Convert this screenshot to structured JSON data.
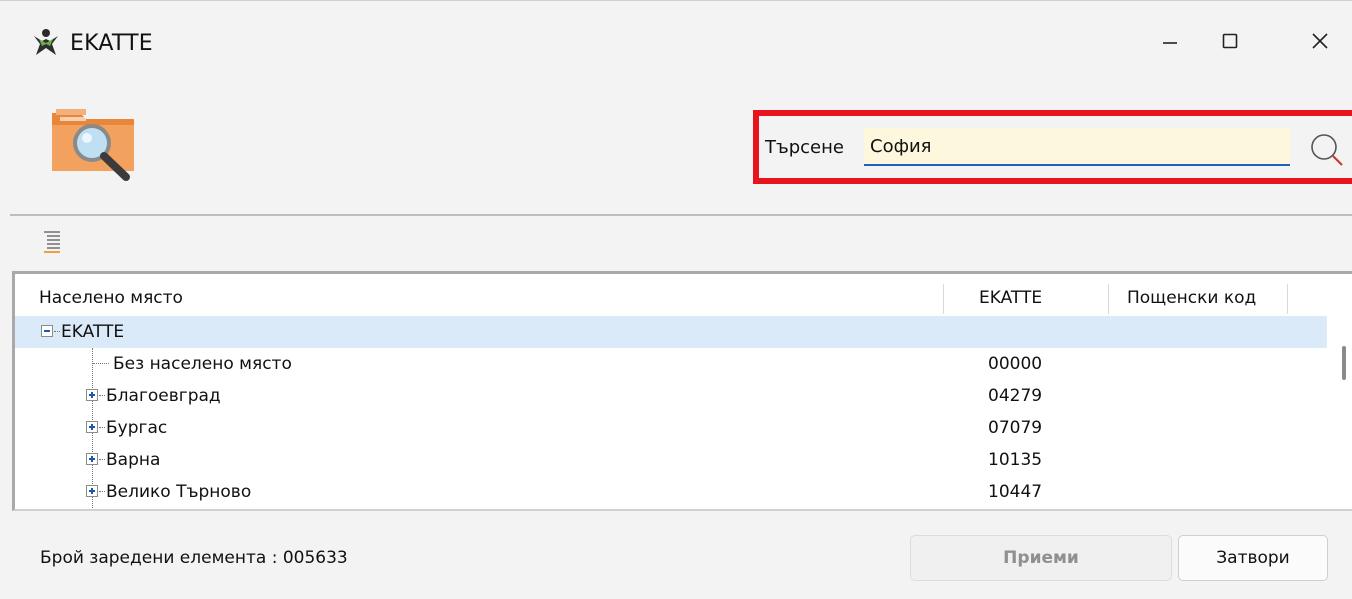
{
  "window": {
    "title": "EKATTE",
    "controls": {
      "minimize": "—",
      "maximize": "☐",
      "close": "✕"
    }
  },
  "search": {
    "label": "Търсене",
    "value": "София",
    "highlight_color": "#e8141d",
    "input_bg": "#fdf7dd"
  },
  "grid": {
    "columns": [
      "Населено място",
      "EKATTE",
      "Пощенски код"
    ],
    "rows": [
      {
        "name": "EKATTE",
        "code": "",
        "level": 0,
        "expander": "minus",
        "selected": true
      },
      {
        "name": "Без населено място",
        "code": "00000",
        "level": 1,
        "expander": "none"
      },
      {
        "name": "Благоевград",
        "code": "04279",
        "level": 1,
        "expander": "plus"
      },
      {
        "name": "Бургас",
        "code": "07079",
        "level": 1,
        "expander": "plus"
      },
      {
        "name": "Варна",
        "code": "10135",
        "level": 1,
        "expander": "plus"
      },
      {
        "name": "Велико Търново",
        "code": "10447",
        "level": 1,
        "expander": "plus"
      }
    ],
    "selection_color": "#dbeaf9"
  },
  "footer": {
    "status": "Брой заредени елемента : 005633",
    "accept_label": "Приеми",
    "close_label": "Затвори"
  },
  "icons": {
    "app": "ekatte-app-icon",
    "folder": "folder-search-icon",
    "search": "magnifier-icon",
    "toolbar": "collapse-tree-icon"
  }
}
